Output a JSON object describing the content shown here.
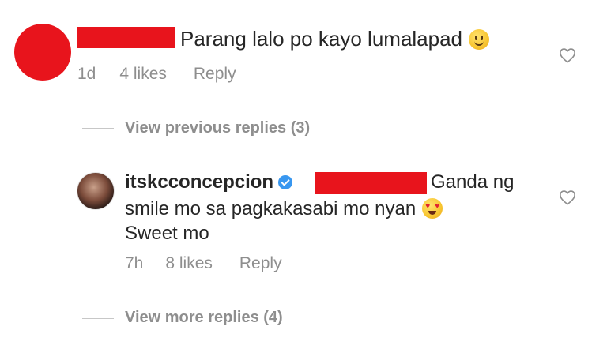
{
  "comments": [
    {
      "text": "Parang lalo po kayo lumalapad",
      "emoji": "slightly-smiling-face",
      "time": "1d",
      "likes": "4 likes",
      "reply_label": "Reply",
      "view_replies": "View previous replies (3)"
    },
    {
      "username": "itskcconcepcion",
      "verified": true,
      "text_line1": "Ganda ng",
      "text_line2": "smile mo sa pagkakasabi mo nyan",
      "text_line3": "Sweet mo",
      "emoji": "heart-eyes-face",
      "time": "7h",
      "likes": "8 likes",
      "reply_label": "Reply",
      "view_replies": "View more replies (4)"
    }
  ],
  "colors": {
    "redaction": "#e8141c",
    "text": "#262626",
    "muted": "#8e8e8e",
    "verified": "#3897f0"
  }
}
